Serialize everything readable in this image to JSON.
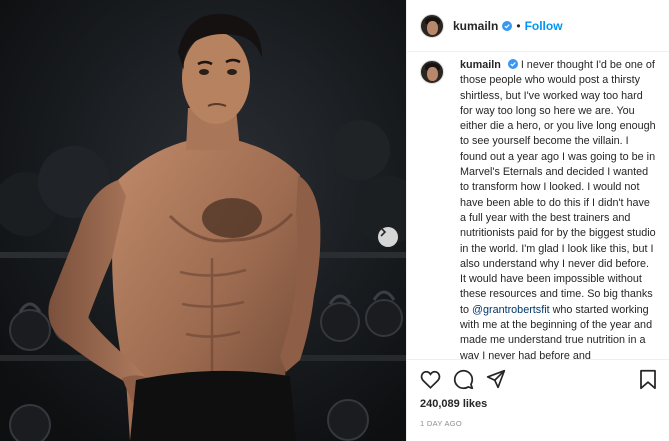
{
  "post": {
    "username": "kumailn",
    "follow_label": "Follow",
    "separator": "•",
    "caption_prefix": "I never thought I'd be one of those people who would post a thirsty shirtless, but I've worked way too hard for way too long so here we are. You either die a hero, or you live long enough to see yourself become the villain. I found out a year ago I was going to be in Marvel's Eternals and decided I wanted to transform how I looked. I would not have been able to do this if I didn't have a full year with the best trainers and nutritionists paid for by the biggest studio in the world. I'm glad I look like this, but I also understand why I never did before. It would have been impossible without these resources and time. So big thanks to ",
    "mention": "@grantrobertsfit",
    "caption_suffix": " who started working with me at the beginning of the year and made me understand true nutrition in a way I never had before and",
    "likes": "240,089 likes",
    "timestamp": "1 DAY AGO"
  },
  "icons": {
    "verified": "verified-badge-icon",
    "next": "chevron-right-icon",
    "like": "heart-icon",
    "comment": "comment-bubble-icon",
    "share": "paper-plane-icon",
    "save": "bookmark-icon"
  },
  "colors": {
    "accent": "#0095f6",
    "mention": "#00376b",
    "muted": "#8e8e8e",
    "verified": "#3897f0"
  }
}
